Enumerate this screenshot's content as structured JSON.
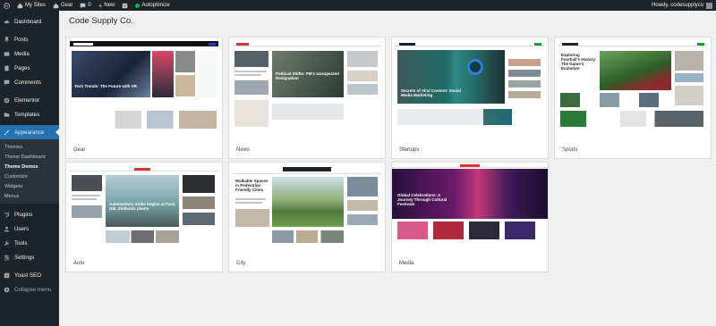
{
  "adminbar": {
    "my_sites": "My Sites",
    "site_name": "Gear",
    "comments_count": "0",
    "new_label": "New",
    "autoptimize": "Autoptimize",
    "howdy": "Howdy, codesupplyco"
  },
  "sidebar": {
    "items": [
      {
        "label": "Dashboard",
        "icon": "dashboard-icon"
      },
      {
        "label": "Posts",
        "icon": "pin-icon"
      },
      {
        "label": "Media",
        "icon": "media-icon"
      },
      {
        "label": "Pages",
        "icon": "page-icon"
      },
      {
        "label": "Comments",
        "icon": "comment-icon"
      },
      {
        "label": "Elementor",
        "icon": "elementor-icon"
      },
      {
        "label": "Templates",
        "icon": "folder-icon"
      },
      {
        "label": "Appearance",
        "icon": "brush-icon"
      },
      {
        "label": "Plugins",
        "icon": "plug-icon"
      },
      {
        "label": "Users",
        "icon": "user-icon"
      },
      {
        "label": "Tools",
        "icon": "wrench-icon"
      },
      {
        "label": "Settings",
        "icon": "sliders-icon"
      },
      {
        "label": "Yoast SEO",
        "icon": "yoast-icon"
      },
      {
        "label": "Collapse menu",
        "icon": "collapse-icon"
      }
    ],
    "appearance_submenu": [
      "Themes",
      "Theme Dashboard",
      "Theme Demos",
      "Customize",
      "Widgets",
      "Menus"
    ]
  },
  "page": {
    "title": "Code Supply Co."
  },
  "demos": [
    {
      "label": "Gear",
      "headline": "Tech Trends: The Future with VR",
      "logo": "The Newsreader",
      "accent": "#2c3bd1"
    },
    {
      "label": "News",
      "headline": "Political Shifts: PM's Unexpected Resignation",
      "logo": "The Newsreader",
      "accent": "#d63638"
    },
    {
      "label": "Startups",
      "headline": "Secrets of Viral Content: Social Media Marketing",
      "logo": "The Newsreader",
      "accent": "#00a32a"
    },
    {
      "label": "Sports",
      "headline": "Exploring Football's History: The Game's Evolution",
      "logo": "The Newsreader",
      "accent": "#00a32a"
    },
    {
      "label": "Auto",
      "headline": "Autoworkers strike begins at Ford, GM, Stellantis plants",
      "logo": "READER",
      "accent": "#d63638"
    },
    {
      "label": "City",
      "headline": "Walkable Spaces in Pedestrian Friendly Cities",
      "logo": "The Newsreader",
      "accent": "#1d7a3a"
    },
    {
      "label": "Media",
      "headline": "Global Celebrations: A Journey Through Cultural Festivals",
      "logo": "Newsreader",
      "accent": "#d63638"
    }
  ]
}
